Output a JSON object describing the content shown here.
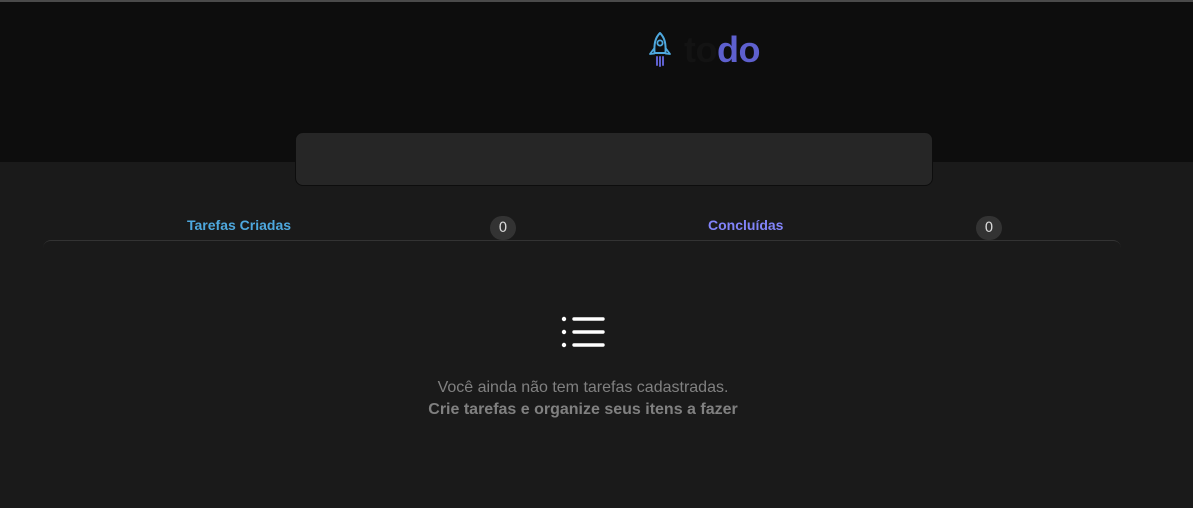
{
  "header": {
    "logo_icon": "rocket-icon",
    "logo_to": "to",
    "logo_do": "do",
    "colors": {
      "to": "#131313",
      "do": "#5e60ce",
      "rocket": "#4ea8de"
    }
  },
  "task_input": {
    "value": "",
    "placeholder": ""
  },
  "counters": {
    "created_label": "Tarefas Criadas",
    "created_count": "0",
    "done_label": "Concluídas",
    "done_count": "0",
    "colors": {
      "created": "#4ea8de",
      "done": "#8284fa"
    }
  },
  "empty_state": {
    "icon": "list-icon",
    "line1": "Você ainda não tem tarefas cadastradas.",
    "line2": "Crie tarefas e organize seus itens a fazer"
  }
}
